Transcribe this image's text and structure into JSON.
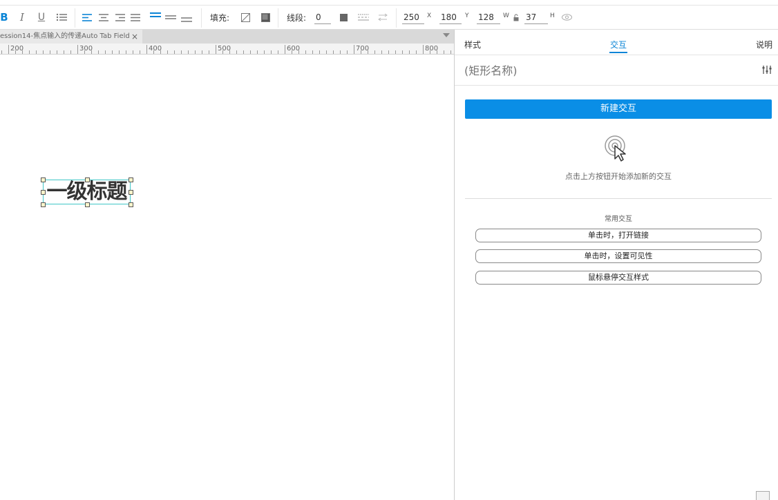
{
  "toolbar": {
    "bold": "B",
    "italic": "I",
    "underline": "U",
    "fill_label": "填充:",
    "stroke_label": "线段:",
    "stroke_value": "0",
    "x_value": "250",
    "x_suffix": "X",
    "y_value": "180",
    "y_suffix": "Y",
    "w_value": "128",
    "w_suffix": "W",
    "h_value": "37",
    "h_suffix": "H"
  },
  "document_tab": {
    "title": "ession14-焦点输入的传递Auto Tab Field",
    "close": "×"
  },
  "ruler": {
    "labels": [
      "200",
      "300",
      "400",
      "500",
      "600",
      "700",
      "800"
    ]
  },
  "canvas": {
    "widget_text": "一级标题"
  },
  "panel": {
    "tabs": {
      "style": "样式",
      "interaction": "交互",
      "notes": "说明"
    },
    "name_placeholder": "(矩形名称)",
    "new_interaction_button": "新建交互",
    "empty_hint": "点击上方按钮开始添加新的交互",
    "common_title": "常用交互",
    "common_items": [
      "单击时，打开链接",
      "单击时，设置可见性",
      "鼠标悬停交互样式"
    ]
  },
  "colors": {
    "accent": "#0a8ee6",
    "selection": "#3fc6c6"
  }
}
